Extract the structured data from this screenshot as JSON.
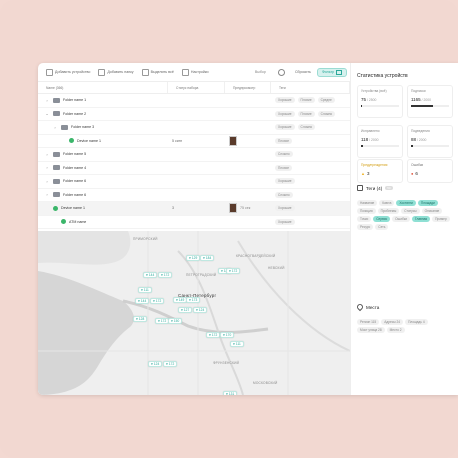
{
  "toolbar": {
    "add_device": "Добавить устройство",
    "add_group": "Добавить папку",
    "select_all": "Выделить всё",
    "settings": "Настройки",
    "select_value": "Выбор",
    "reset": "Сбросить",
    "apply": "Фильтр"
  },
  "columns": [
    "Name (366)",
    "Статус набора",
    "Предпросмотр",
    "Теги"
  ],
  "rows": [
    {
      "type": "folder",
      "name": "Folder name 1",
      "indent": 0,
      "tags": [
        "Хорошие",
        "Плохие",
        "Средне"
      ]
    },
    {
      "type": "folder",
      "name": "Folder name 2",
      "indent": 0,
      "open": true,
      "tags": [
        "Хорошие",
        "Плохие",
        "Сложно"
      ]
    },
    {
      "type": "folder",
      "name": "Folder name 3",
      "indent": 1,
      "tags": [
        "Хорошие",
        "Сложно"
      ]
    },
    {
      "type": "device",
      "name": "Device name 1",
      "indent": 2,
      "status": "5 сигн",
      "tags": [
        "Плохие"
      ]
    },
    {
      "type": "folder",
      "name": "Folder name 5",
      "indent": 0,
      "tags": [
        "Сложно"
      ]
    },
    {
      "type": "folder",
      "name": "Folder name 4",
      "indent": 0,
      "tags": [
        "Плохие"
      ]
    },
    {
      "type": "folder",
      "name": "Folder name 6",
      "indent": 0,
      "tags": [
        "Хорошие"
      ]
    },
    {
      "type": "folder",
      "name": "Folder name 6",
      "indent": 0,
      "tags": [
        "Сложно"
      ]
    },
    {
      "type": "device",
      "name": "Device name 1",
      "indent": 0,
      "selected": true,
      "status": "3",
      "preview": "75 сек",
      "tags": [
        "Хорошие"
      ]
    },
    {
      "type": "device",
      "name": "ATM name",
      "indent": 1,
      "tags": [
        "Хорошие"
      ]
    },
    {
      "type": "folder",
      "name": "Project name 1",
      "indent": 0,
      "status": "157 завершено",
      "tags": [
        "Хорошие"
      ]
    }
  ],
  "sidebar": {
    "title": "Статистика устройств",
    "stats": [
      {
        "label": "Устройства (всё)",
        "value": "75",
        "total": "/ 2500",
        "fill": 0.03
      },
      {
        "label": "Подписки",
        "value": "1165",
        "total": "/ 2000",
        "fill": 0.58
      },
      {
        "label": "Исправлено",
        "value": "118",
        "total": "/ 2000",
        "fill": 0.06
      },
      {
        "label": "Подведения",
        "value": "88",
        "total": "/ 2000",
        "fill": 0.04
      },
      {
        "label": "Предупреждения",
        "value": "3",
        "total": ""
      },
      {
        "label": "Ошибки",
        "value": "6",
        "total": ""
      }
    ],
    "tags_title": "Теги (4)",
    "tags_count": "50",
    "tags": [
      {
        "label": "Название",
        "on": false
      },
      {
        "label": "Каюта",
        "on": false
      },
      {
        "label": "Хостинги",
        "on": true
      },
      {
        "label": "Площади",
        "on": true
      },
      {
        "label": "Позиция",
        "on": false
      },
      {
        "label": "Проблемы",
        "on": false
      },
      {
        "label": "Статусы",
        "on": false
      },
      {
        "label": "Описание",
        "on": false
      },
      {
        "label": "Точки",
        "on": false
      },
      {
        "label": "Сервис",
        "on": true
      },
      {
        "label": "Ошибки",
        "on": false
      },
      {
        "label": "Главная",
        "on": true
      },
      {
        "label": "Пример",
        "on": false
      },
      {
        "label": "Ресурс",
        "on": false
      },
      {
        "label": "Сеть",
        "on": false
      }
    ],
    "places_title": "Места",
    "places": [
      "Регион 115",
      "Адресы 24",
      "Площадь 4",
      "Мост улица 28",
      "Место 2"
    ]
  },
  "map": {
    "pins": [
      "144",
      "172",
      "129",
      "184",
      "144",
      "172",
      "128",
      "111",
      "144",
      "172",
      "149",
      "173",
      "127",
      "124",
      "172",
      "150",
      "172",
      "170",
      "111",
      "124",
      "172",
      "131"
    ],
    "labels": [
      "ПРИМОРСКИЙ",
      "КРАСНОГВАРДЕЙСКИЙ",
      "ПЕТРОГРАДСКИЙ",
      "Санкт-Петербург",
      "НЕВСКИЙ",
      "ФРУНЗЕНСКИЙ",
      "МОСКОВСКИЙ"
    ]
  }
}
